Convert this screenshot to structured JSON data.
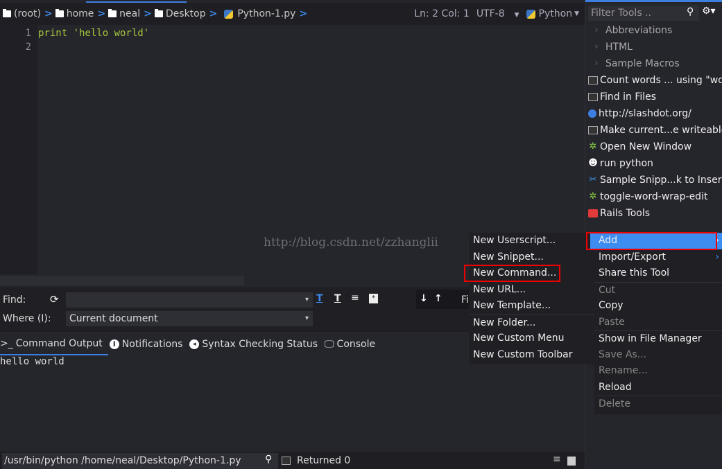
{
  "breadcrumb": [
    "(root)",
    "home",
    "neal",
    "Desktop",
    "Python-1.py"
  ],
  "status": {
    "position": "Ln: 2 Col: 1",
    "encoding": "UTF-8",
    "language": "Python"
  },
  "editor": {
    "line_numbers": [
      "1",
      "2"
    ],
    "lines": [
      "print 'hello world'",
      ""
    ]
  },
  "watermark": "http://blog.csdn.net/zzhanglii",
  "find": {
    "find_label": "Find:",
    "find_value": "",
    "where_label": "Where (I):",
    "where_value": "Current document",
    "truncated_label": "Fi"
  },
  "bottom_tabs": [
    {
      "label": "Command Output",
      "icon": "terminal-icon"
    },
    {
      "label": "Notifications",
      "icon": "info-icon"
    },
    {
      "label": "Syntax Checking Status",
      "icon": "syntax-icon"
    },
    {
      "label": "Console",
      "icon": "monitor-icon"
    }
  ],
  "output": "hello world",
  "command_bar": {
    "command": "/usr/bin/python  /home/neal/Desktop/Python-1.py",
    "result": "Returned 0"
  },
  "sidebar": {
    "filter_placeholder": "Filter Tools ..",
    "items": [
      {
        "label": "Abbreviations",
        "icon": "chevron-right-icon"
      },
      {
        "label": "HTML",
        "icon": "chevron-right-icon"
      },
      {
        "label": "Sample Macros",
        "icon": "chevron-right-icon"
      },
      {
        "label": "Count words ... using \"wc\"",
        "icon": "terminal-icon"
      },
      {
        "label": "Find in Files",
        "icon": "terminal-icon"
      },
      {
        "label": "http://slashdot.org/",
        "icon": "globe-icon"
      },
      {
        "label": "Make current...e writeable",
        "icon": "terminal-icon"
      },
      {
        "label": "Open New Window",
        "icon": "macro-icon"
      },
      {
        "label": "run python",
        "icon": "face-icon"
      },
      {
        "label": "Sample Snipp...k to Insert",
        "icon": "scissors-icon"
      },
      {
        "label": "toggle-word-wrap-edit",
        "icon": "macro-icon"
      },
      {
        "label": "Rails Tools",
        "icon": "toolbox-icon"
      }
    ]
  },
  "context_menu": [
    {
      "label": "Add",
      "submenu": true,
      "highlighted": true
    },
    {
      "label": "Import/Export",
      "submenu": true
    },
    {
      "label": "Share this Tool"
    },
    {
      "label": "Cut",
      "disabled": true,
      "sep": true
    },
    {
      "label": "Copy"
    },
    {
      "label": "Paste",
      "disabled": true
    },
    {
      "label": "Show in File Manager",
      "sep": true
    },
    {
      "label": "Save As...",
      "disabled": true
    },
    {
      "label": "Rename...",
      "disabled": true
    },
    {
      "label": "Reload"
    },
    {
      "label": "Delete",
      "disabled": true,
      "sep": true
    }
  ],
  "add_submenu": [
    {
      "label": "New Userscript..."
    },
    {
      "label": "New Snippet..."
    },
    {
      "label": "New Command...",
      "boxed": true
    },
    {
      "label": "New URL..."
    },
    {
      "label": "New Template..."
    },
    {
      "label": "New Folder...",
      "sep": true
    },
    {
      "label": "New Custom Menu"
    },
    {
      "label": "New Custom Toolbar"
    }
  ],
  "colors": {
    "accent": "#3d8cf0",
    "highlight_box": "#e00000",
    "string": "#a6c83c"
  }
}
